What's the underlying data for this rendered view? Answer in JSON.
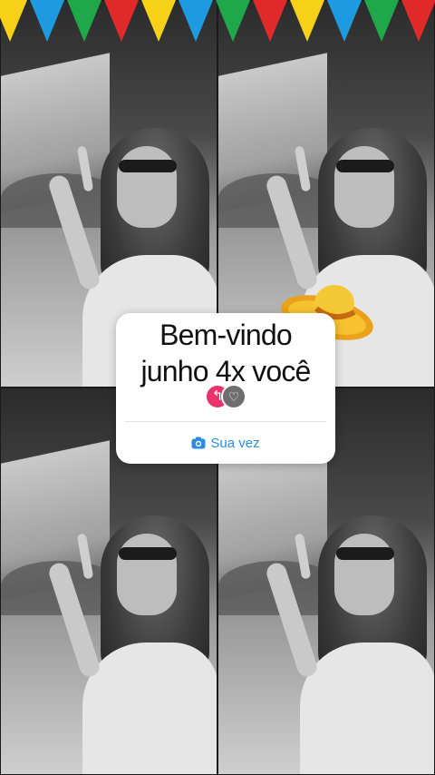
{
  "story_card": {
    "title_line1": "Bem-vindo",
    "title_line2": "junho 4x você",
    "action_label": "Sua vez"
  },
  "icons": {
    "avatar_primary": "share-arrow-icon",
    "avatar_secondary": "heart-icon",
    "action": "camera-icon",
    "sticker": "straw-hat-sticker"
  },
  "colors": {
    "accent_blue": "#2b8de2",
    "avatar_pink": "#e8336d",
    "card_bg": "#ffffff",
    "bunting": [
      "#f7d117",
      "#1e9be0",
      "#1ea84a",
      "#e02a2a",
      "#f7d117",
      "#1e9be0",
      "#1ea84a",
      "#e02a2a",
      "#f7d117",
      "#1e9be0",
      "#1ea84a",
      "#e02a2a"
    ]
  }
}
